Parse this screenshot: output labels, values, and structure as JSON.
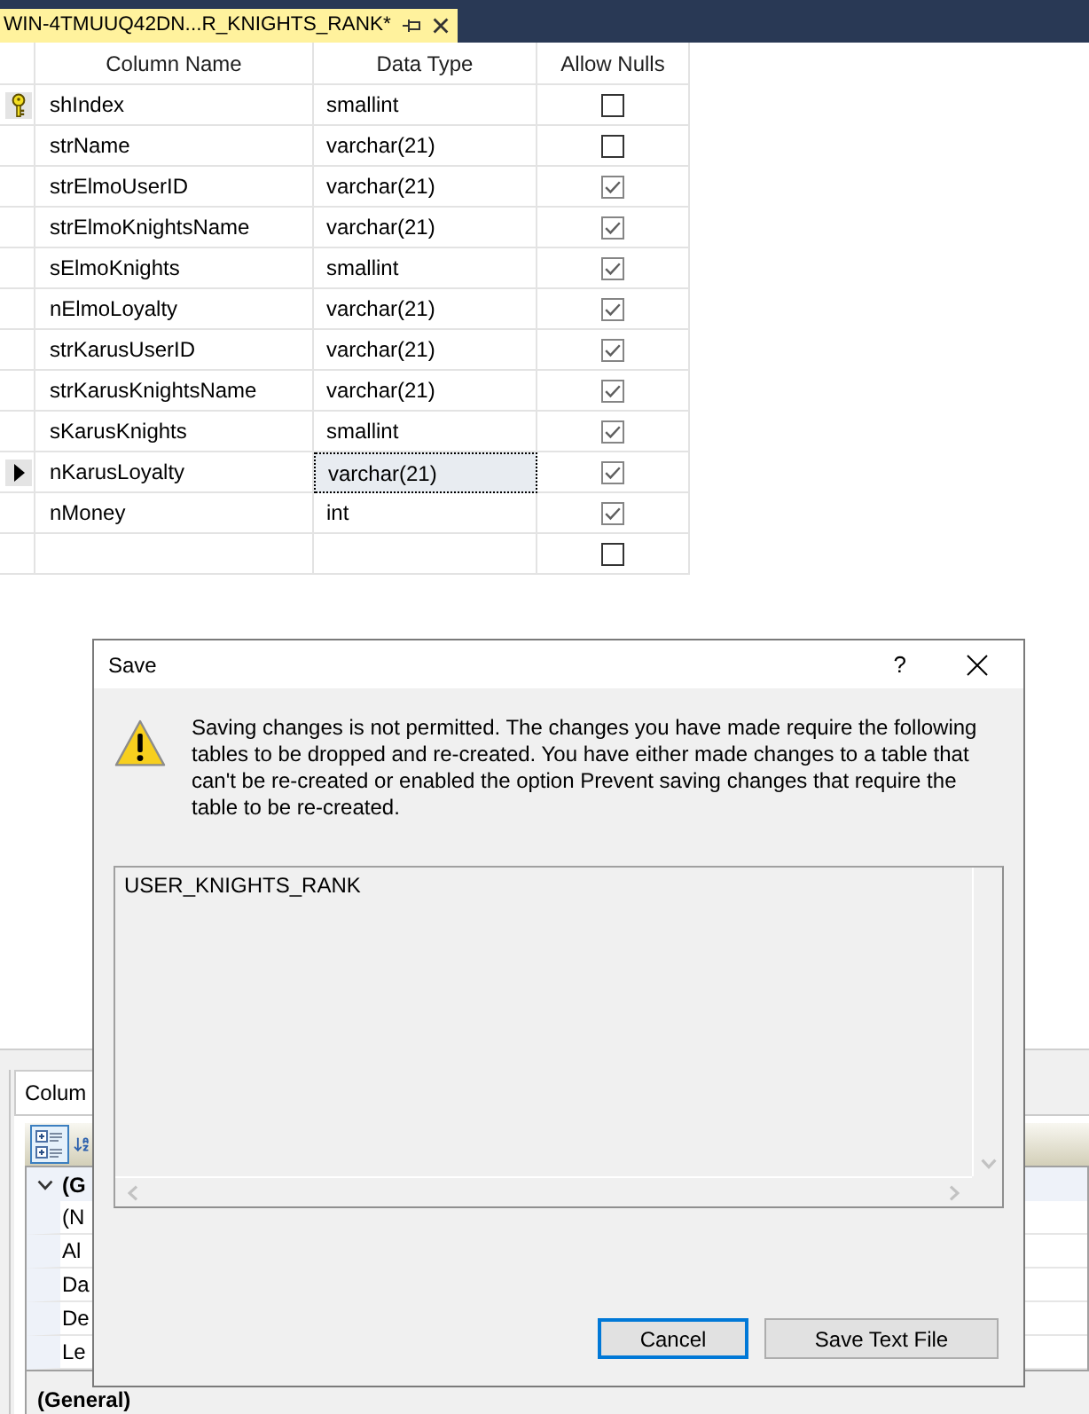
{
  "tabs": [
    {
      "label": "WIN-4TMUUQ42DN...R_KNIGHTS_RANK*",
      "selected": true
    }
  ],
  "table": {
    "columns": [
      "Column Name",
      "Data Type",
      "Allow Nulls"
    ],
    "rows": [
      {
        "name": "shIndex",
        "data_type": "smallint",
        "allow_nulls": false,
        "primary_key": true,
        "selected": false
      },
      {
        "name": "strName",
        "data_type": "varchar(21)",
        "allow_nulls": false,
        "primary_key": false,
        "selected": false
      },
      {
        "name": "strElmoUserID",
        "data_type": "varchar(21)",
        "allow_nulls": true,
        "primary_key": false,
        "selected": false
      },
      {
        "name": "strElmoKnightsName",
        "data_type": "varchar(21)",
        "allow_nulls": true,
        "primary_key": false,
        "selected": false
      },
      {
        "name": "sElmoKnights",
        "data_type": "smallint",
        "allow_nulls": true,
        "primary_key": false,
        "selected": false
      },
      {
        "name": "nElmoLoyalty",
        "data_type": "varchar(21)",
        "allow_nulls": true,
        "primary_key": false,
        "selected": false
      },
      {
        "name": "strKarusUserID",
        "data_type": "varchar(21)",
        "allow_nulls": true,
        "primary_key": false,
        "selected": false
      },
      {
        "name": "strKarusKnightsName",
        "data_type": "varchar(21)",
        "allow_nulls": true,
        "primary_key": false,
        "selected": false
      },
      {
        "name": "sKarusKnights",
        "data_type": "smallint",
        "allow_nulls": true,
        "primary_key": false,
        "selected": false
      },
      {
        "name": "nKarusLoyalty",
        "data_type": "varchar(21)",
        "allow_nulls": true,
        "primary_key": false,
        "selected": true
      },
      {
        "name": "nMoney",
        "data_type": "int",
        "allow_nulls": true,
        "primary_key": false,
        "selected": false
      },
      {
        "allow_nulls": false,
        "primary_key": false,
        "selected": false
      }
    ]
  },
  "properties_panel": {
    "tab": {
      "label": "Colum",
      "selected": true
    },
    "toolbar": [
      {
        "kind": "categorized",
        "selected": true
      },
      {
        "kind": "alphabetical",
        "selected": false
      }
    ],
    "grid": [
      {
        "kind": "category",
        "label": "(G",
        "expanded": true
      },
      {
        "kind": "property",
        "label": "(N"
      },
      {
        "kind": "property",
        "label": "Al"
      },
      {
        "kind": "property",
        "label": "Da"
      },
      {
        "kind": "property",
        "label": "De"
      },
      {
        "kind": "property",
        "label": "Le"
      }
    ],
    "description": "(General)"
  },
  "dialog": {
    "title": "Save",
    "help": "?",
    "message": "Saving changes is not permitted. The changes you have made require the following tables to be dropped and re-created. You have either made changes to a table that can't be re-created or enabled the option Prevent saving changes that require the table to be re-created.",
    "tables": [
      "USER_KNIGHTS_RANK"
    ],
    "buttons": [
      {
        "label": "Cancel",
        "focused": true
      },
      {
        "label": "Save Text File",
        "focused": false
      }
    ]
  }
}
